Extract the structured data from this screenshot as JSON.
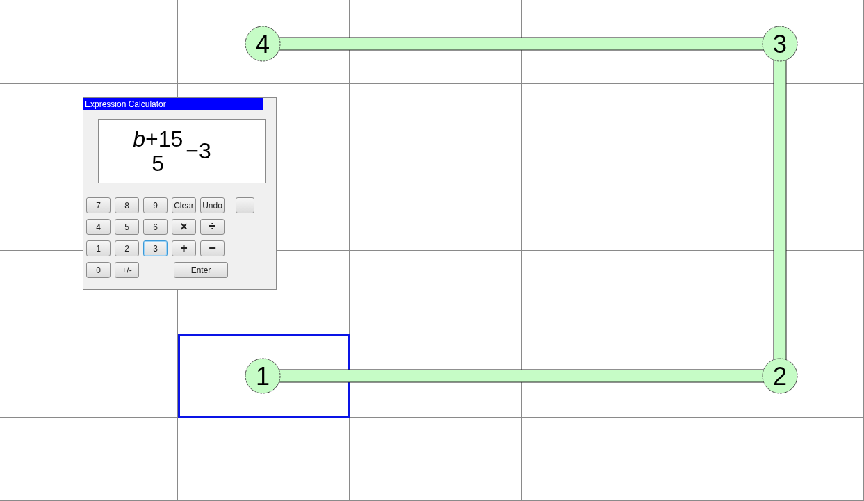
{
  "grid": {
    "rows": [
      {
        "cells": [
          {
            "selected": false
          },
          {
            "selected": false
          },
          {
            "selected": false
          },
          {
            "selected": false
          },
          {
            "selected": false
          }
        ]
      },
      {
        "cells": [
          {
            "selected": false
          },
          {
            "selected": false
          },
          {
            "selected": false
          },
          {
            "selected": false
          },
          {
            "selected": false
          }
        ]
      },
      {
        "cells": [
          {
            "selected": false
          },
          {
            "selected": false
          },
          {
            "selected": false
          },
          {
            "selected": false
          },
          {
            "selected": false
          }
        ]
      },
      {
        "cells": [
          {
            "selected": false
          },
          {
            "selected": false
          },
          {
            "selected": false
          },
          {
            "selected": false
          },
          {
            "selected": false
          }
        ]
      },
      {
        "cells": [
          {
            "selected": false
          },
          {
            "selected": true
          },
          {
            "selected": false
          },
          {
            "selected": false
          },
          {
            "selected": false
          }
        ]
      },
      {
        "cells": [
          {
            "selected": false
          },
          {
            "selected": false
          },
          {
            "selected": false
          },
          {
            "selected": false
          },
          {
            "selected": false
          }
        ]
      }
    ]
  },
  "nodes": [
    {
      "label": "4"
    },
    {
      "label": "3"
    },
    {
      "label": "1"
    },
    {
      "label": "2"
    }
  ],
  "calculator": {
    "title": "Expression Calculator",
    "display": {
      "numerator": "*b*+15",
      "denominator": "5",
      "suffix": "−3"
    },
    "button_rows": [
      [
        {
          "label": "7",
          "kind": "key",
          "focused": false
        },
        {
          "label": "8",
          "kind": "key",
          "focused": false
        },
        {
          "label": "9",
          "kind": "key",
          "focused": false
        },
        {
          "label": "Clear",
          "kind": "key",
          "focused": false
        },
        {
          "label": "Undo",
          "kind": "key",
          "focused": false
        },
        {
          "kind": "blank",
          "focused": false
        }
      ],
      [
        {
          "label": "4",
          "kind": "key",
          "focused": false
        },
        {
          "label": "5",
          "kind": "key",
          "focused": false
        },
        {
          "label": "6",
          "kind": "key",
          "focused": false
        },
        {
          "label": "×",
          "kind": "op",
          "focused": false
        },
        {
          "label": "÷",
          "kind": "op",
          "focused": false
        }
      ],
      [
        {
          "label": "1",
          "kind": "key",
          "focused": false
        },
        {
          "label": "2",
          "kind": "key",
          "focused": false
        },
        {
          "label": "3",
          "kind": "key",
          "focused": true
        },
        {
          "label": "+",
          "kind": "op",
          "focused": false
        },
        {
          "label": "−",
          "kind": "op",
          "focused": false
        }
      ],
      [
        {
          "label": "0",
          "kind": "key",
          "focused": false
        },
        {
          "label": "+/-",
          "kind": "key",
          "focused": false
        },
        {
          "label": "Enter",
          "kind": "wide",
          "focused": false
        }
      ]
    ]
  }
}
